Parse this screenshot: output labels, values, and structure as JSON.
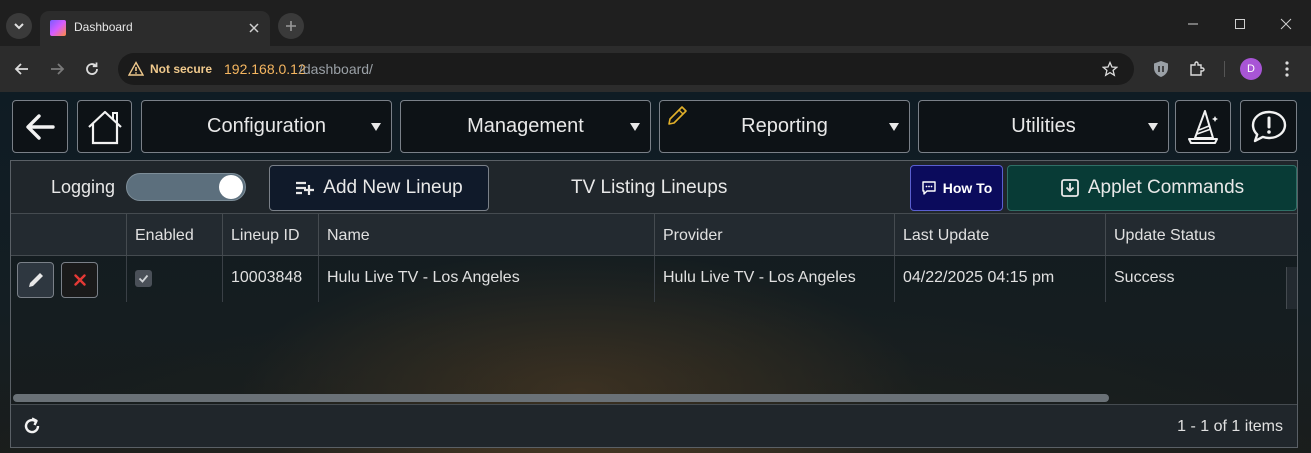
{
  "browser": {
    "tab_title": "Dashboard",
    "security_label": "Not secure",
    "url_host": "192.168.0.12",
    "url_path": "/dashboard/",
    "profile_initial": "D"
  },
  "nav": {
    "configuration": "Configuration",
    "management": "Management",
    "reporting": "Reporting",
    "utilities": "Utilities"
  },
  "panel": {
    "logging_label": "Logging",
    "logging_on": true,
    "add_button": "Add New Lineup",
    "title": "TV Listing Lineups",
    "howto_button": "How To",
    "applet_button": "Applet Commands"
  },
  "table": {
    "columns": [
      "Enabled",
      "Lineup ID",
      "Name",
      "Provider",
      "Last Update",
      "Update Status"
    ],
    "rows": [
      {
        "enabled": true,
        "lineup_id": "10003848",
        "name": "Hulu Live TV - Los Angeles",
        "provider": "Hulu Live TV - Los Angeles",
        "last_update": "04/22/2025 04:15 pm",
        "update_status": "Success"
      }
    ]
  },
  "footer": {
    "pager": "1 - 1 of 1 items"
  },
  "colors": {
    "accent_orange": "#f5b660",
    "howto_bg": "#0b0b5c",
    "applet_bg": "#083b36",
    "delete_red": "#e53935"
  }
}
